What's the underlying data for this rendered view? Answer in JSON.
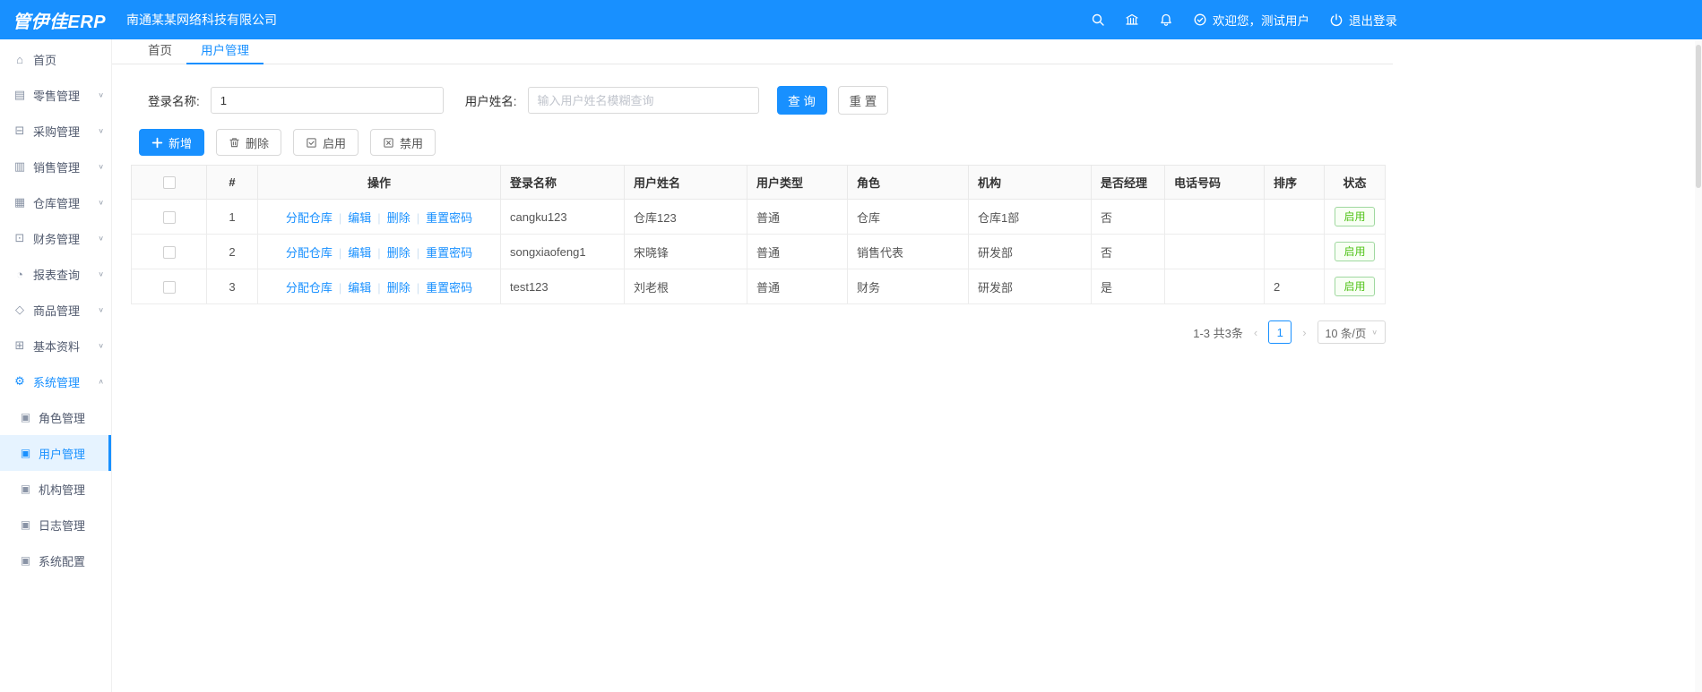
{
  "header": {
    "logo": "管伊佳ERP",
    "company": "南通某某网络科技有限公司",
    "welcome": "欢迎您，测试用户",
    "logout": "退出登录",
    "icons": [
      "search-icon",
      "bank-icon",
      "bell-icon",
      "check-circle-icon",
      "power-icon"
    ]
  },
  "sidebar": {
    "items": [
      {
        "label": "首页",
        "icon": "home-icon"
      },
      {
        "label": "零售管理",
        "icon": "retail-icon"
      },
      {
        "label": "采购管理",
        "icon": "purchase-icon"
      },
      {
        "label": "销售管理",
        "icon": "sales-icon"
      },
      {
        "label": "仓库管理",
        "icon": "warehouse-icon"
      },
      {
        "label": "财务管理",
        "icon": "finance-icon"
      },
      {
        "label": "报表查询",
        "icon": "report-icon"
      },
      {
        "label": "商品管理",
        "icon": "goods-icon"
      },
      {
        "label": "基本资料",
        "icon": "basic-data-icon"
      },
      {
        "label": "系统管理",
        "icon": "gear-icon",
        "expanded": true,
        "active": true
      }
    ],
    "system_children": [
      {
        "label": "角色管理",
        "icon": "doc-icon"
      },
      {
        "label": "用户管理",
        "icon": "doc-icon",
        "active": true
      },
      {
        "label": "机构管理",
        "icon": "doc-icon"
      },
      {
        "label": "日志管理",
        "icon": "doc-icon"
      },
      {
        "label": "系统配置",
        "icon": "doc-icon"
      }
    ]
  },
  "tabs": [
    {
      "label": "首页",
      "active": false
    },
    {
      "label": "用户管理",
      "active": true
    }
  ],
  "filter": {
    "login_name_label": "登录名称:",
    "login_name_value": "1",
    "user_name_label": "用户姓名:",
    "user_name_placeholder": "输入用户姓名模糊查询",
    "search_button": "查 询",
    "reset_button": "重 置"
  },
  "toolbar": {
    "add": "新增",
    "delete": "删除",
    "enable": "启用",
    "disable": "禁用"
  },
  "table": {
    "columns": [
      "#",
      "操作",
      "登录名称",
      "用户姓名",
      "用户类型",
      "角色",
      "机构",
      "是否经理",
      "电话号码",
      "排序",
      "状态"
    ],
    "action_links": [
      "分配仓库",
      "编辑",
      "删除",
      "重置密码"
    ],
    "rows": [
      {
        "index": "1",
        "login_name": "cangku123",
        "user_name": "仓库123",
        "user_type": "普通",
        "role": "仓库",
        "org": "仓库1部",
        "is_manager": "否",
        "phone": "",
        "sort": "",
        "status": "启用"
      },
      {
        "index": "2",
        "login_name": "songxiaofeng1",
        "user_name": "宋晓锋",
        "user_type": "普通",
        "role": "销售代表",
        "org": "研发部",
        "is_manager": "否",
        "phone": "",
        "sort": "",
        "status": "启用"
      },
      {
        "index": "3",
        "login_name": "test123",
        "user_name": "刘老根",
        "user_type": "普通",
        "role": "财务",
        "org": "研发部",
        "is_manager": "是",
        "phone": "",
        "sort": "2",
        "status": "启用"
      }
    ]
  },
  "pagination": {
    "total_text": "1-3 共3条",
    "prev": "‹",
    "current_page": "1",
    "next": "›",
    "page_size": "10 条/页"
  },
  "colors": {
    "primary": "#1890ff",
    "success": "#52c41a"
  }
}
